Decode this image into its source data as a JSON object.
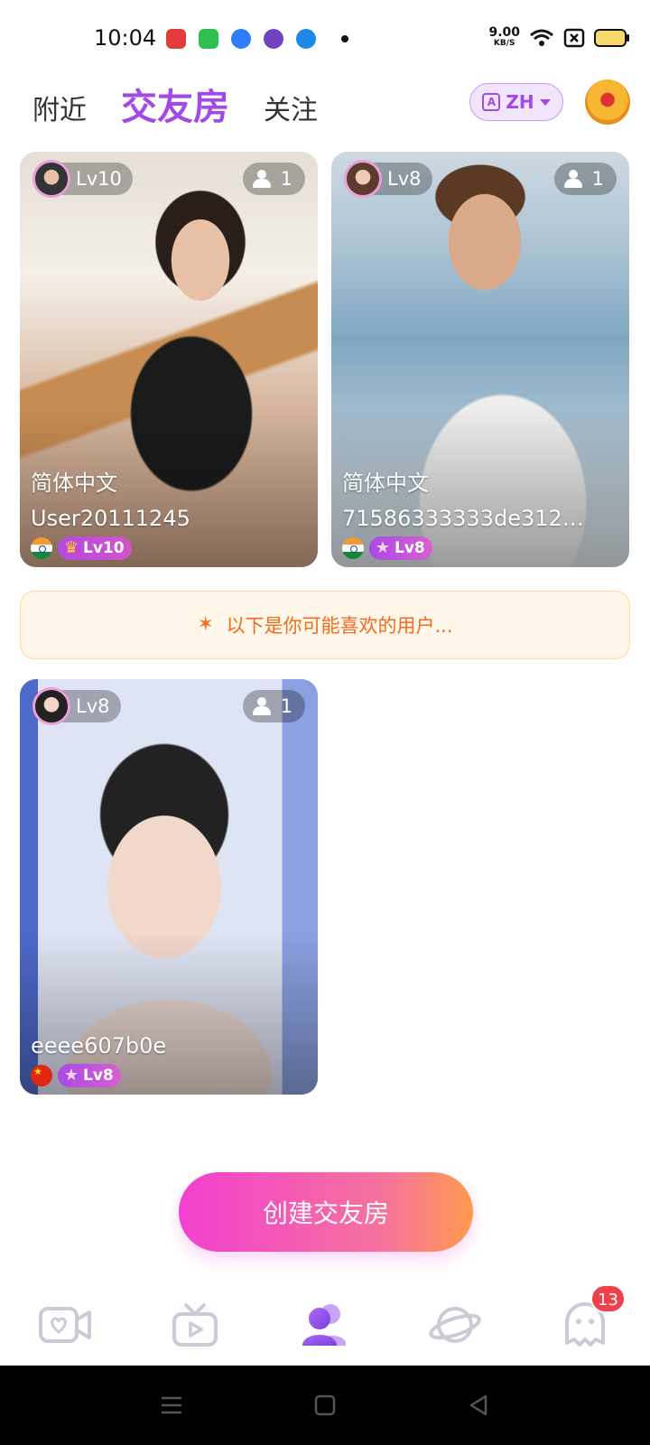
{
  "status_bar": {
    "time": "10:04",
    "net_speed_value": "9.00",
    "net_speed_unit": "KB/S",
    "app_icon_colors": [
      "#e23b3b",
      "#2fbf4f",
      "#2d7ff9",
      "#6f42c1",
      "#1e88e5"
    ]
  },
  "header": {
    "tabs": [
      {
        "label": "附近",
        "active": false
      },
      {
        "label": "交友房",
        "active": true
      },
      {
        "label": "关注",
        "active": false
      }
    ],
    "language_button": {
      "label": "ZH",
      "icon": "translate-icon"
    },
    "avatar_icon": "user-avatar"
  },
  "rooms": [
    {
      "host_level": "Lv10",
      "viewers": "1",
      "language": "简体中文",
      "name": "User20111245",
      "country": "in",
      "badge_icon": "crown-icon",
      "badge_level": "Lv10"
    },
    {
      "host_level": "Lv8",
      "viewers": "1",
      "language": "简体中文",
      "name": "71586333333de312…",
      "country": "in",
      "badge_icon": "star-icon",
      "badge_level": "Lv8"
    },
    {
      "host_level": "Lv8",
      "viewers": "1",
      "language": "",
      "name": "eeee607b0e",
      "country": "cn",
      "badge_icon": "star-icon",
      "badge_level": "Lv8"
    }
  ],
  "suggestion": {
    "text": "以下是你可能喜欢的用户...",
    "icon": "speaker-icon"
  },
  "create_button": {
    "label": "创建交友房"
  },
  "bottom_nav": {
    "items": [
      {
        "icon": "video-call-icon",
        "active": false
      },
      {
        "icon": "tv-live-icon",
        "active": false
      },
      {
        "icon": "friends-room-icon",
        "active": true
      },
      {
        "icon": "planet-icon",
        "active": false
      },
      {
        "icon": "ghost-chat-icon",
        "active": false,
        "badge": "13"
      }
    ]
  },
  "colors": {
    "accent": "#a349e8",
    "inactive_icon": "#c9cbd6",
    "badge": "#f0404a",
    "suggest_text": "#f26a1b",
    "create_gradient_start": "#f23fd0",
    "create_gradient_end": "#ff9a50"
  }
}
